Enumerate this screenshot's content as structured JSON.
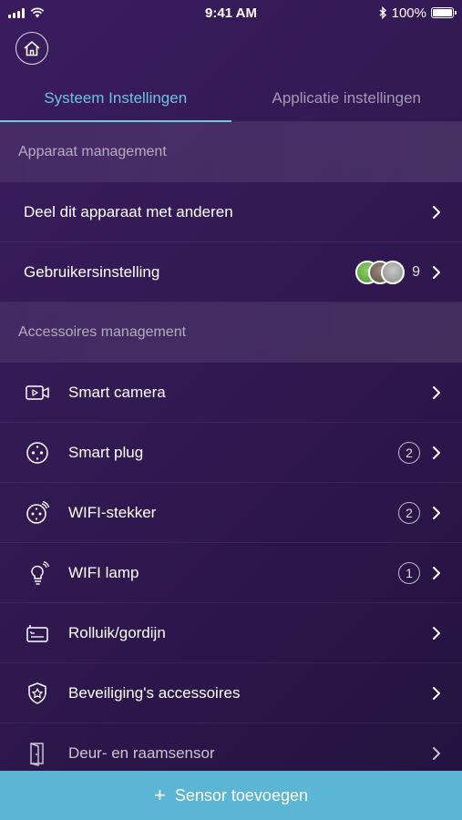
{
  "status_bar": {
    "time": "9:41 AM",
    "battery": "100%"
  },
  "tabs": [
    {
      "label": "Systeem Instellingen",
      "active": true
    },
    {
      "label": "Applicatie instellingen",
      "active": false
    }
  ],
  "sections": {
    "device": {
      "title": "Apparaat management",
      "rows": {
        "share": {
          "label": "Deel dit apparaat met anderen"
        },
        "users": {
          "label": "Gebruikersinstelling",
          "count": "9"
        }
      }
    },
    "accessories": {
      "title": "Accessoires management",
      "rows": {
        "camera": {
          "label": "Smart camera",
          "icon": "camera-icon"
        },
        "plug": {
          "label": "Smart plug",
          "count": "2",
          "icon": "plug-icon"
        },
        "wifi_plug": {
          "label": "WIFI-stekker",
          "count": "2",
          "icon": "wifi-plug-icon"
        },
        "lamp": {
          "label": "WIFI lamp",
          "count": "1",
          "icon": "lamp-icon"
        },
        "blind": {
          "label": "Rolluik/gordijn",
          "icon": "blind-icon"
        },
        "security": {
          "label": "Beveiliging's accessoires",
          "icon": "shield-icon"
        },
        "door": {
          "label": "Deur- en raamsensor",
          "icon": "door-sensor-icon"
        }
      }
    }
  },
  "bottom_button": {
    "label": "Sensor toevoegen"
  },
  "colors": {
    "accent": "#6cc4e0",
    "button": "#5bb5d4",
    "background": "#331a55"
  }
}
